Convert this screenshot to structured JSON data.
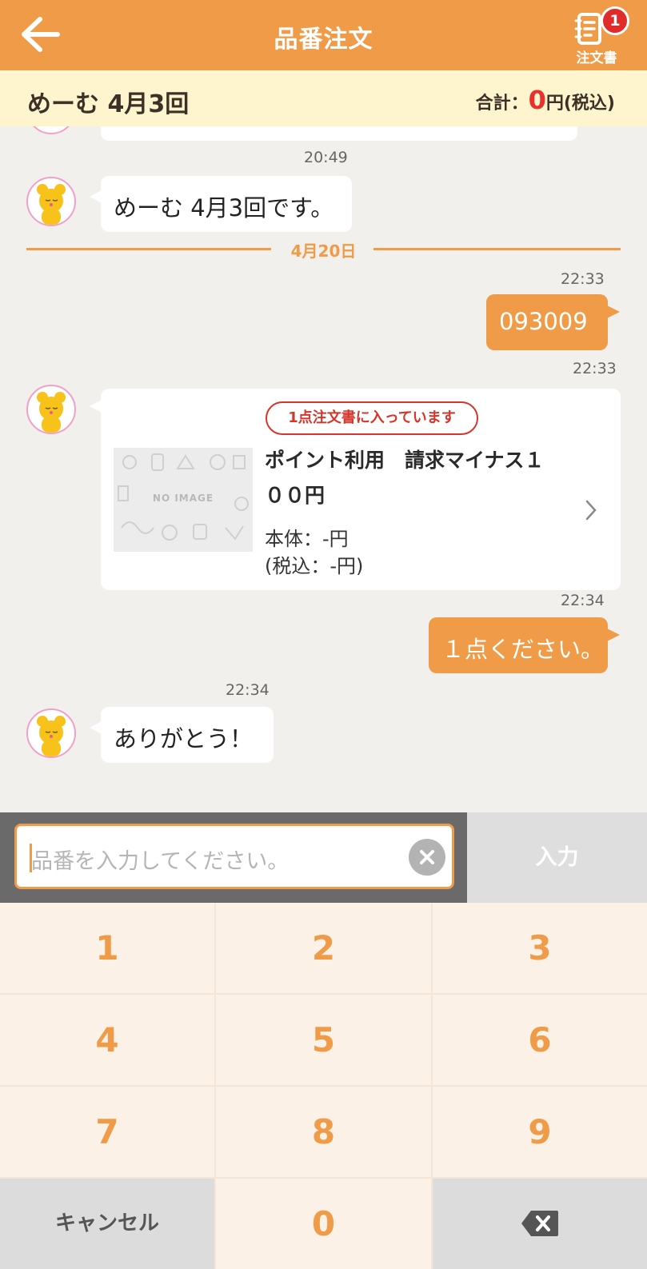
{
  "header": {
    "title": "品番注文",
    "cart_label": "注文書",
    "cart_badge": "1"
  },
  "summary": {
    "name": "めーむ 4月3回",
    "total_prefix": "合計：",
    "total_amount": "0",
    "total_suffix": "円(税込)"
  },
  "chat": {
    "time_1": "20:49",
    "msg_1": "めーむ 4月3回です。",
    "date_separator": "4月20日",
    "time_2": "22:33",
    "msg_2": "093009",
    "time_3": "22:33",
    "product": {
      "in_cart_badge": "1点注文書に入っています",
      "no_image": "NO IMAGE",
      "name_line1": "ポイント利用　請求マイナス１",
      "name_line2": "００円",
      "price_body": "本体：-円",
      "price_tax": "(税込：-円)"
    },
    "time_4": "22:34",
    "msg_3": "１点ください。",
    "time_5": "22:34",
    "msg_4": "ありがとう！"
  },
  "input": {
    "placeholder": "品番を入力してください。",
    "enter_label": "入力"
  },
  "keypad": {
    "k1": "1",
    "k2": "2",
    "k3": "3",
    "k4": "4",
    "k5": "5",
    "k6": "6",
    "k7": "7",
    "k8": "8",
    "k9": "9",
    "cancel": "キャンセル",
    "k0": "0"
  },
  "colors": {
    "brand": "#ef9b48",
    "summary_bg": "#fef5cf",
    "total_red": "#e8312b",
    "chat_bg": "#f1f0ec"
  }
}
